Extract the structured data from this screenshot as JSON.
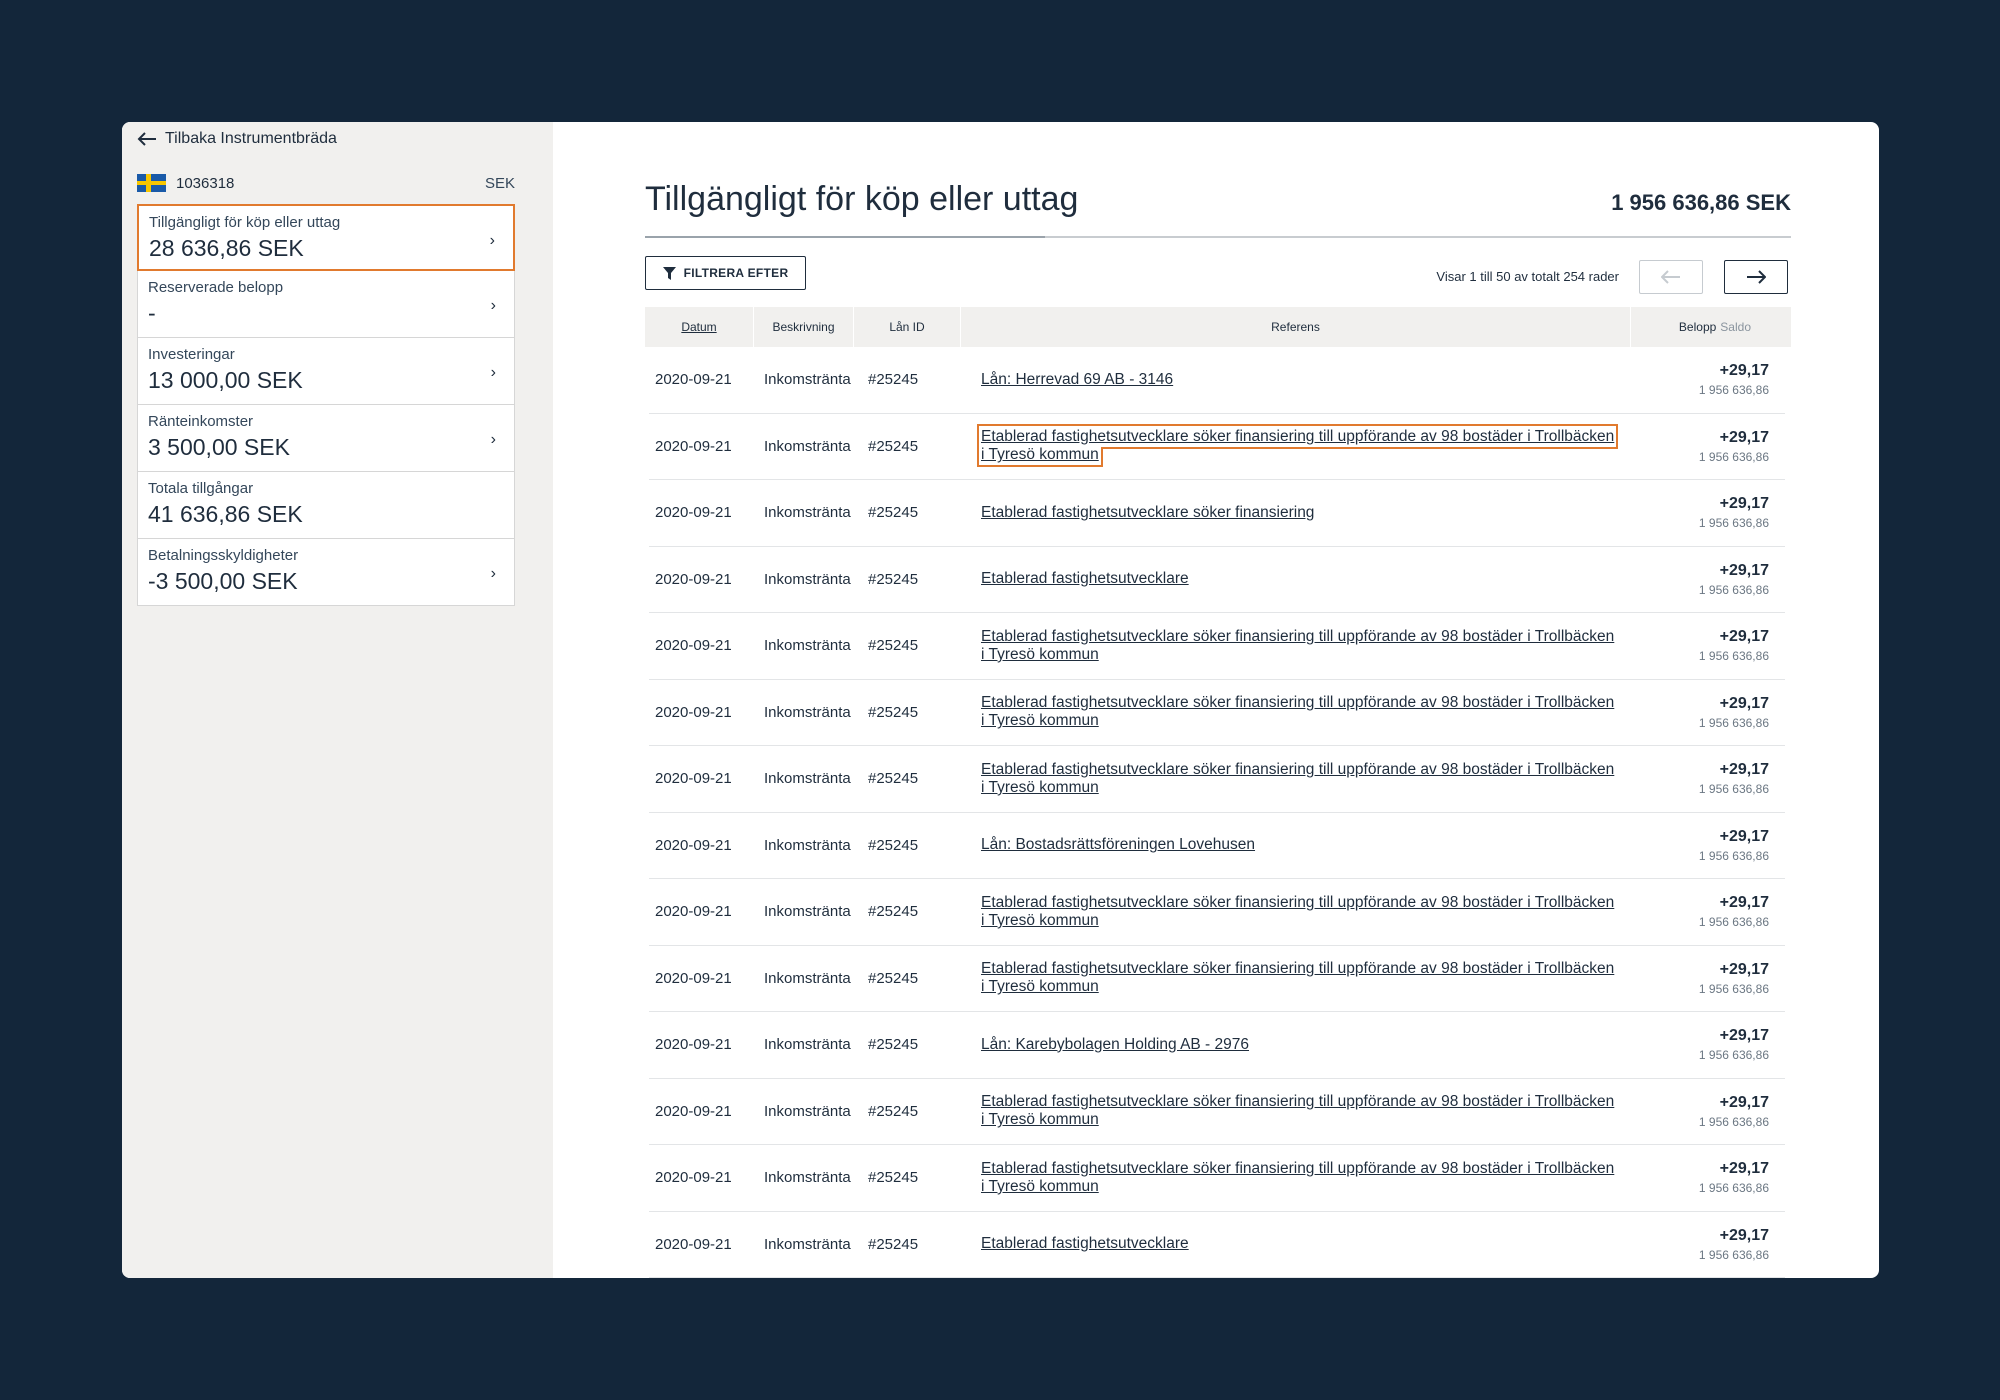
{
  "sidebar": {
    "back_label": "Tilbaka Instrumentbräda",
    "account_number": "1036318",
    "account_currency": "SEK",
    "cards": [
      {
        "label": "Tillgängligt för köp eller uttag",
        "value": "28 636,86 SEK",
        "has_chevron": true
      },
      {
        "label": "Reserverade belopp",
        "value": "-",
        "has_chevron": true
      },
      {
        "label": "Investeringar",
        "value": "13 000,00 SEK",
        "has_chevron": true
      },
      {
        "label": "Ränteinkomster",
        "value": "3 500,00 SEK",
        "has_chevron": true
      },
      {
        "label": "Totala tillgångar",
        "value": "41 636,86 SEK",
        "has_chevron": false
      },
      {
        "label": "Betalningsskyldigheter",
        "value": "-3 500,00 SEK",
        "has_chevron": true
      }
    ]
  },
  "main": {
    "title": "Tillgängligt för köp eller uttag",
    "total": "1 956 636,86 SEK",
    "filter_label": "FILTRERA EFTER",
    "showing_text": "Visar 1 till 50 av totalt 254 rader",
    "columns": {
      "date": "Datum",
      "desc": "Beskrivning",
      "loan": "Lån ID",
      "ref": "Referens",
      "amount": "Belopp",
      "saldo": "Saldo"
    },
    "rows": [
      {
        "date": "2020-09-21",
        "desc": "Inkomstränta",
        "loan": "#25245",
        "ref": "Lån: Herrevad 69 AB - 3146",
        "amount": "+29,17",
        "balance": "1 956 636,86"
      },
      {
        "date": "2020-09-21",
        "desc": "Inkomstränta",
        "loan": "#25245",
        "ref": "Etablerad fastighetsutvecklare söker finansiering till uppförande av 98 bostäder i Trollbäcken i Tyresö kommun",
        "amount": "+29,17",
        "balance": "1 956 636,86"
      },
      {
        "date": "2020-09-21",
        "desc": "Inkomstränta",
        "loan": "#25245",
        "ref": "Etablerad fastighetsutvecklare söker finansiering",
        "amount": "+29,17",
        "balance": "1 956 636,86"
      },
      {
        "date": "2020-09-21",
        "desc": "Inkomstränta",
        "loan": "#25245",
        "ref": "Etablerad fastighetsutvecklare",
        "amount": "+29,17",
        "balance": "1 956 636,86"
      },
      {
        "date": "2020-09-21",
        "desc": "Inkomstränta",
        "loan": "#25245",
        "ref": "Etablerad fastighetsutvecklare söker finansiering till uppförande av 98 bostäder i Trollbäcken i Tyresö kommun",
        "amount": "+29,17",
        "balance": "1 956 636,86"
      },
      {
        "date": "2020-09-21",
        "desc": "Inkomstränta",
        "loan": "#25245",
        "ref": "Etablerad fastighetsutvecklare söker finansiering till uppförande av 98 bostäder i Trollbäcken i Tyresö kommun",
        "amount": "+29,17",
        "balance": "1 956 636,86"
      },
      {
        "date": "2020-09-21",
        "desc": "Inkomstränta",
        "loan": "#25245",
        "ref": "Etablerad fastighetsutvecklare söker finansiering till uppförande av 98 bostäder i Trollbäcken i Tyresö kommun",
        "amount": "+29,17",
        "balance": "1 956 636,86"
      },
      {
        "date": "2020-09-21",
        "desc": "Inkomstränta",
        "loan": "#25245",
        "ref": "Lån: Bostadsrättsföreningen Lovehusen",
        "amount": "+29,17",
        "balance": "1 956 636,86"
      },
      {
        "date": "2020-09-21",
        "desc": "Inkomstränta",
        "loan": "#25245",
        "ref": "Etablerad fastighetsutvecklare söker finansiering till uppförande av 98 bostäder i Trollbäcken i Tyresö kommun",
        "amount": "+29,17",
        "balance": "1 956 636,86"
      },
      {
        "date": "2020-09-21",
        "desc": "Inkomstränta",
        "loan": "#25245",
        "ref": "Etablerad fastighetsutvecklare söker finansiering till uppförande av 98 bostäder i Trollbäcken i Tyresö kommun",
        "amount": "+29,17",
        "balance": "1 956 636,86"
      },
      {
        "date": "2020-09-21",
        "desc": "Inkomstränta",
        "loan": "#25245",
        "ref": "Lån: Karebybolagen Holding AB - 2976",
        "amount": "+29,17",
        "balance": "1 956 636,86"
      },
      {
        "date": "2020-09-21",
        "desc": "Inkomstränta",
        "loan": "#25245",
        "ref": "Etablerad fastighetsutvecklare söker finansiering till uppförande av 98 bostäder i Trollbäcken i Tyresö kommun",
        "amount": "+29,17",
        "balance": "1 956 636,86"
      },
      {
        "date": "2020-09-21",
        "desc": "Inkomstränta",
        "loan": "#25245",
        "ref": "Etablerad fastighetsutvecklare söker finansiering till uppförande av 98 bostäder i Trollbäcken i Tyresö kommun",
        "amount": "+29,17",
        "balance": "1 956 636,86"
      },
      {
        "date": "2020-09-21",
        "desc": "Inkomstränta",
        "loan": "#25245",
        "ref": "Etablerad fastighetsutvecklare",
        "amount": "+29,17",
        "balance": "1 956 636,86"
      }
    ]
  },
  "colors": {
    "background": "#13263a",
    "accent": "#e17a2e",
    "text": "#1f2d3d"
  }
}
